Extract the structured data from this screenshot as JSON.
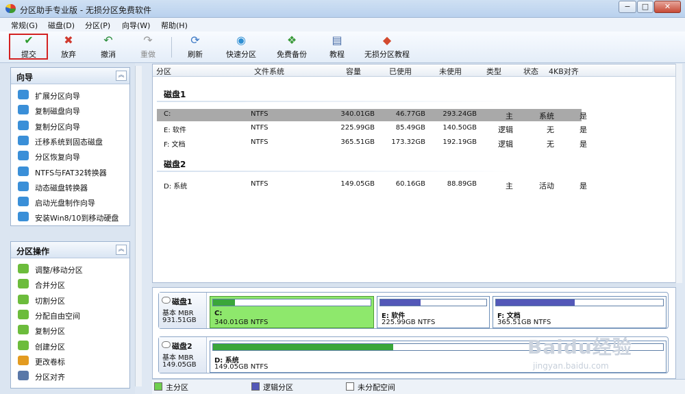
{
  "window": {
    "title": "分区助手专业版 - 无损分区免费软件",
    "controls": {
      "minimize": "−",
      "maximize": "□",
      "close": "✕"
    }
  },
  "menu": [
    {
      "label": "常规(G)"
    },
    {
      "label": "磁盘(D)"
    },
    {
      "label": "分区(P)"
    },
    {
      "label": "向导(W)"
    },
    {
      "label": "帮助(H)"
    }
  ],
  "toolbar": {
    "commit": {
      "label": "提交",
      "icon": "check-icon",
      "glyph": "✔"
    },
    "discard": {
      "label": "放弃",
      "icon": "discard-icon",
      "glyph": "✖"
    },
    "undo": {
      "label": "撤消",
      "icon": "undo-icon",
      "glyph": "↶"
    },
    "redo": {
      "label": "重做",
      "icon": "redo-icon",
      "glyph": "↷"
    },
    "refresh": {
      "label": "刷新",
      "icon": "refresh-icon",
      "glyph": "⟳"
    },
    "quick_partition": {
      "label": "快速分区",
      "icon": "quick-partition-icon",
      "glyph": "◉"
    },
    "free_backup": {
      "label": "免费备份",
      "icon": "backup-icon",
      "glyph": "❖"
    },
    "tutorial": {
      "label": "教程",
      "icon": "tutorial-icon",
      "glyph": "▤"
    },
    "lossless_tutorial": {
      "label": "无损分区教程",
      "icon": "lossless-icon",
      "glyph": "◆"
    }
  },
  "sidebar": {
    "wizard_panel": {
      "title": "向导",
      "items": [
        {
          "label": "扩展分区向导",
          "color": "#3a8fd8"
        },
        {
          "label": "复制磁盘向导",
          "color": "#3a8fd8"
        },
        {
          "label": "复制分区向导",
          "color": "#3a8fd8"
        },
        {
          "label": "迁移系统到固态磁盘",
          "color": "#3a8fd8"
        },
        {
          "label": "分区恢复向导",
          "color": "#3a8fd8"
        },
        {
          "label": "NTFS与FAT32转换器",
          "color": "#3a8fd8"
        },
        {
          "label": "动态磁盘转换器",
          "color": "#3a8fd8"
        },
        {
          "label": "启动光盘制作向导",
          "color": "#3a8fd8"
        },
        {
          "label": "安装Win8/10到移动硬盘",
          "color": "#3a8fd8"
        }
      ]
    },
    "ops_panel": {
      "title": "分区操作",
      "items": [
        {
          "label": "调整/移动分区",
          "color": "#6cbc3c"
        },
        {
          "label": "合并分区",
          "color": "#6cbc3c"
        },
        {
          "label": "切割分区",
          "color": "#6cbc3c"
        },
        {
          "label": "分配自由空间",
          "color": "#6cbc3c"
        },
        {
          "label": "复制分区",
          "color": "#6cbc3c"
        },
        {
          "label": "创建分区",
          "color": "#6cbc3c"
        },
        {
          "label": "更改卷标",
          "color": "#e39b20"
        },
        {
          "label": "分区对齐",
          "color": "#5a78a8"
        }
      ]
    }
  },
  "table": {
    "columns": [
      "分区",
      "文件系统",
      "容量",
      "已使用",
      "未使用",
      "类型",
      "状态",
      "4KB对齐"
    ],
    "disks": [
      {
        "name": "磁盘1",
        "rows": [
          {
            "partition": "C:",
            "fs": "NTFS",
            "capacity": "340.01GB",
            "used": "46.77GB",
            "free": "293.24GB",
            "type": "主",
            "status": "系统",
            "align": "是",
            "selected": true
          },
          {
            "partition": "E: 软件",
            "fs": "NTFS",
            "capacity": "225.99GB",
            "used": "85.49GB",
            "free": "140.50GB",
            "type": "逻辑",
            "status": "无",
            "align": "是",
            "selected": false
          },
          {
            "partition": "F: 文档",
            "fs": "NTFS",
            "capacity": "365.51GB",
            "used": "173.32GB",
            "free": "192.19GB",
            "type": "逻辑",
            "status": "无",
            "align": "是",
            "selected": false
          }
        ]
      },
      {
        "name": "磁盘2",
        "rows": [
          {
            "partition": "D: 系统",
            "fs": "NTFS",
            "capacity": "149.05GB",
            "used": "60.16GB",
            "free": "88.89GB",
            "type": "主",
            "status": "活动",
            "align": "是",
            "selected": false
          }
        ]
      }
    ]
  },
  "diskmap": {
    "disk1": {
      "name": "磁盘1",
      "type": "基本 MBR",
      "size": "931.51GB",
      "partitions": [
        {
          "name": "C:",
          "size": "340.01GB NTFS",
          "used_fraction": 0.14,
          "fill": "#3aa63a",
          "selected": true
        },
        {
          "name": "E: 软件",
          "size": "225.99GB NTFS",
          "used_fraction": 0.38,
          "fill": "#5358b8",
          "selected": false
        },
        {
          "name": "F: 文档",
          "size": "365.51GB NTFS",
          "used_fraction": 0.47,
          "fill": "#5358b8",
          "selected": false
        }
      ]
    },
    "disk2": {
      "name": "磁盘2",
      "type": "基本 MBR",
      "size": "149.05GB",
      "partitions": [
        {
          "name": "D: 系统",
          "size": "149.05GB NTFS",
          "used_fraction": 0.4,
          "fill": "#3aa63a",
          "selected": false
        }
      ]
    }
  },
  "legend": {
    "primary": {
      "label": "主分区",
      "color": "#6fcf4f"
    },
    "logical": {
      "label": "逻辑分区",
      "color": "#5358b8"
    },
    "unallocated": {
      "label": "未分配空间",
      "color": "#ffffff"
    }
  },
  "watermark": {
    "big": "Baidu经验",
    "small": "jingyan.baidu.com"
  }
}
